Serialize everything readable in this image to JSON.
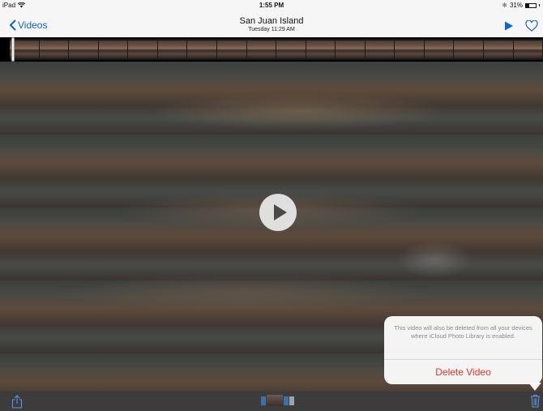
{
  "status_bar": {
    "device": "iPad",
    "time": "1:55 PM",
    "battery": "31%",
    "icons": [
      "wifi-icon",
      "bluetooth-icon",
      "battery-icon"
    ]
  },
  "nav_bar": {
    "back_label": "Videos",
    "title": "San Juan Island",
    "subtitle": "Tuesday  11:29 AM",
    "icons": [
      "chevron-left-icon",
      "play-icon",
      "heart-icon"
    ]
  },
  "popover": {
    "message": "This video will also be deleted from all your devices where iCloud Photo Library is enabled.",
    "action_label": "Delete Video"
  },
  "toolbar": {
    "icons": [
      "share-icon",
      "trash-icon"
    ]
  },
  "colors": {
    "accent": "#0a63d8",
    "destructive": "#e8322b",
    "toolbar": "#3c3c3c",
    "bar_background": "#f6f6f6"
  }
}
